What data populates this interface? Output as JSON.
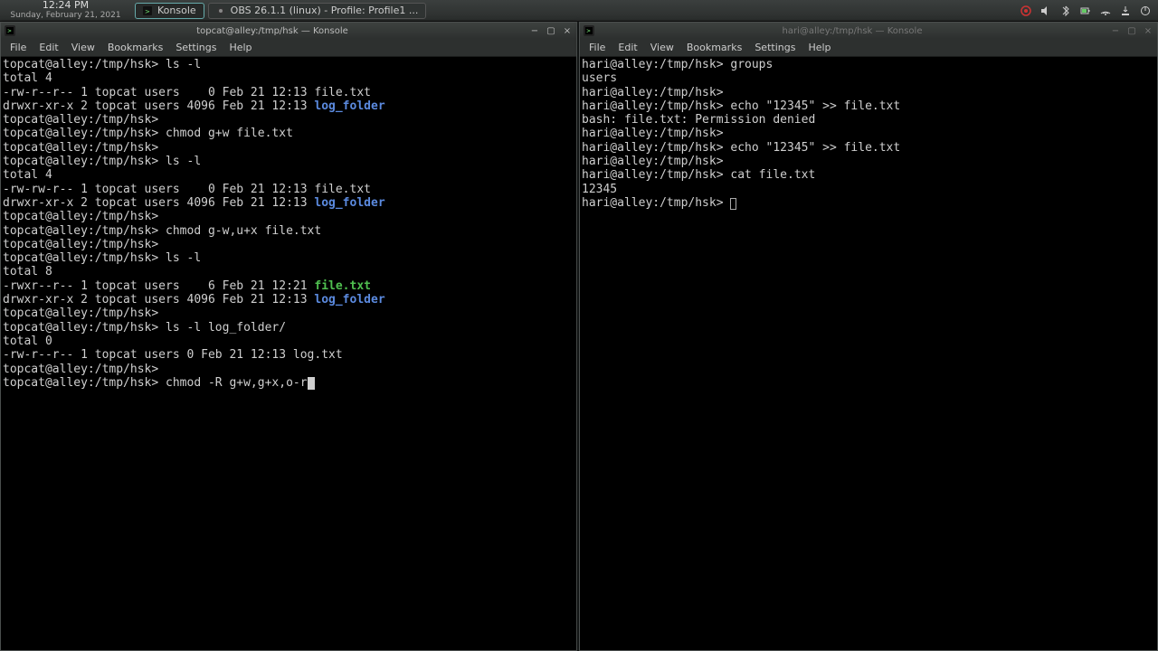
{
  "panel": {
    "time": "12:24 PM",
    "date": "Sunday, February 21, 2021",
    "tasks": [
      {
        "label": "Konsole",
        "active": true
      },
      {
        "label": "OBS 26.1.1 (linux) - Profile: Profile1 ...",
        "active": false
      }
    ],
    "tray_icons": [
      "obs-indicator",
      "volume",
      "bluetooth",
      "battery",
      "network",
      "updates",
      "power-menu"
    ]
  },
  "left_window": {
    "title": "topcat@alley:/tmp/hsk — Konsole",
    "menus": [
      "File",
      "Edit",
      "View",
      "Bookmarks",
      "Settings",
      "Help"
    ],
    "min_icon": "−",
    "max_icon": "▢",
    "close_icon": "×"
  },
  "right_window": {
    "title": "hari@alley:/tmp/hsk — Konsole",
    "menus": [
      "File",
      "Edit",
      "View",
      "Bookmarks",
      "Settings",
      "Help"
    ],
    "min_icon": "−",
    "max_icon": "▢",
    "close_icon": "×"
  },
  "left_term": {
    "lines": [
      {
        "t": "prompt",
        "prompt": "topcat@alley:/tmp/hsk>",
        "cmd": " ls -l"
      },
      {
        "t": "plain",
        "text": "total 4"
      },
      {
        "t": "ls",
        "pre": "-rw-r--r-- 1 topcat users    0 Feb 21 12:13 ",
        "name": "file.txt",
        "cls": ""
      },
      {
        "t": "ls",
        "pre": "drwxr-xr-x 2 topcat users 4096 Feb 21 12:13 ",
        "name": "log_folder",
        "cls": "dir"
      },
      {
        "t": "prompt",
        "prompt": "topcat@alley:/tmp/hsk>",
        "cmd": ""
      },
      {
        "t": "prompt",
        "prompt": "topcat@alley:/tmp/hsk>",
        "cmd": " chmod g+w file.txt"
      },
      {
        "t": "prompt",
        "prompt": "topcat@alley:/tmp/hsk>",
        "cmd": ""
      },
      {
        "t": "prompt",
        "prompt": "topcat@alley:/tmp/hsk>",
        "cmd": " ls -l"
      },
      {
        "t": "plain",
        "text": "total 4"
      },
      {
        "t": "ls",
        "pre": "-rw-rw-r-- 1 topcat users    0 Feb 21 12:13 ",
        "name": "file.txt",
        "cls": ""
      },
      {
        "t": "ls",
        "pre": "drwxr-xr-x 2 topcat users 4096 Feb 21 12:13 ",
        "name": "log_folder",
        "cls": "dir"
      },
      {
        "t": "prompt",
        "prompt": "topcat@alley:/tmp/hsk>",
        "cmd": ""
      },
      {
        "t": "prompt",
        "prompt": "topcat@alley:/tmp/hsk>",
        "cmd": " chmod g-w,u+x file.txt"
      },
      {
        "t": "prompt",
        "prompt": "topcat@alley:/tmp/hsk>",
        "cmd": ""
      },
      {
        "t": "prompt",
        "prompt": "topcat@alley:/tmp/hsk>",
        "cmd": " ls -l"
      },
      {
        "t": "plain",
        "text": "total 8"
      },
      {
        "t": "ls",
        "pre": "-rwxr--r-- 1 topcat users    6 Feb 21 12:21 ",
        "name": "file.txt",
        "cls": "exe"
      },
      {
        "t": "ls",
        "pre": "drwxr-xr-x 2 topcat users 4096 Feb 21 12:13 ",
        "name": "log_folder",
        "cls": "dir"
      },
      {
        "t": "prompt",
        "prompt": "topcat@alley:/tmp/hsk>",
        "cmd": ""
      },
      {
        "t": "prompt",
        "prompt": "topcat@alley:/tmp/hsk>",
        "cmd": " ls -l log_folder/"
      },
      {
        "t": "plain",
        "text": "total 0"
      },
      {
        "t": "plain",
        "text": "-rw-r--r-- 1 topcat users 0 Feb 21 12:13 log.txt"
      },
      {
        "t": "prompt",
        "prompt": "topcat@alley:/tmp/hsk>",
        "cmd": ""
      },
      {
        "t": "prompt",
        "prompt": "topcat@alley:/tmp/hsk>",
        "cmd": " chmod -R g+w,g+x,o-r",
        "cursor": true
      }
    ]
  },
  "right_term": {
    "lines": [
      {
        "t": "prompt",
        "prompt": "hari@alley:/tmp/hsk>",
        "cmd": " groups"
      },
      {
        "t": "plain",
        "text": "users"
      },
      {
        "t": "prompt",
        "prompt": "hari@alley:/tmp/hsk>",
        "cmd": ""
      },
      {
        "t": "prompt",
        "prompt": "hari@alley:/tmp/hsk>",
        "cmd": " echo \"12345\" >> file.txt"
      },
      {
        "t": "plain",
        "text": "bash: file.txt: Permission denied"
      },
      {
        "t": "prompt",
        "prompt": "hari@alley:/tmp/hsk>",
        "cmd": ""
      },
      {
        "t": "prompt",
        "prompt": "hari@alley:/tmp/hsk>",
        "cmd": " echo \"12345\" >> file.txt"
      },
      {
        "t": "prompt",
        "prompt": "hari@alley:/tmp/hsk>",
        "cmd": ""
      },
      {
        "t": "prompt",
        "prompt": "hari@alley:/tmp/hsk>",
        "cmd": " cat file.txt"
      },
      {
        "t": "plain",
        "text": "12345"
      },
      {
        "t": "prompt",
        "prompt": "hari@alley:/tmp/hsk>",
        "cmd": " ",
        "cursor": "hollow"
      }
    ]
  }
}
